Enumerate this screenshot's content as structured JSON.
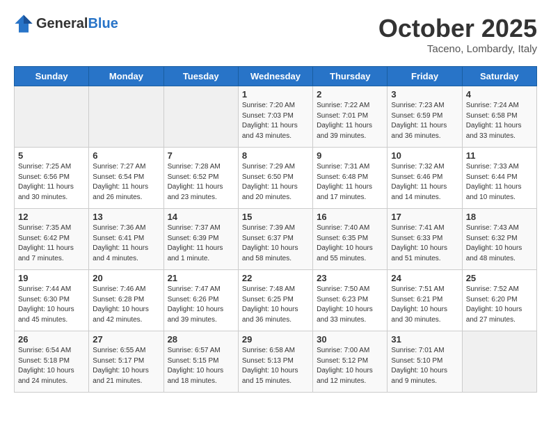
{
  "header": {
    "logo_line1": "General",
    "logo_line2": "Blue",
    "month": "October 2025",
    "location": "Taceno, Lombardy, Italy"
  },
  "days_of_week": [
    "Sunday",
    "Monday",
    "Tuesday",
    "Wednesday",
    "Thursday",
    "Friday",
    "Saturday"
  ],
  "weeks": [
    [
      {
        "day": "",
        "content": ""
      },
      {
        "day": "",
        "content": ""
      },
      {
        "day": "",
        "content": ""
      },
      {
        "day": "1",
        "content": "Sunrise: 7:20 AM\nSunset: 7:03 PM\nDaylight: 11 hours\nand 43 minutes."
      },
      {
        "day": "2",
        "content": "Sunrise: 7:22 AM\nSunset: 7:01 PM\nDaylight: 11 hours\nand 39 minutes."
      },
      {
        "day": "3",
        "content": "Sunrise: 7:23 AM\nSunset: 6:59 PM\nDaylight: 11 hours\nand 36 minutes."
      },
      {
        "day": "4",
        "content": "Sunrise: 7:24 AM\nSunset: 6:58 PM\nDaylight: 11 hours\nand 33 minutes."
      }
    ],
    [
      {
        "day": "5",
        "content": "Sunrise: 7:25 AM\nSunset: 6:56 PM\nDaylight: 11 hours\nand 30 minutes."
      },
      {
        "day": "6",
        "content": "Sunrise: 7:27 AM\nSunset: 6:54 PM\nDaylight: 11 hours\nand 26 minutes."
      },
      {
        "day": "7",
        "content": "Sunrise: 7:28 AM\nSunset: 6:52 PM\nDaylight: 11 hours\nand 23 minutes."
      },
      {
        "day": "8",
        "content": "Sunrise: 7:29 AM\nSunset: 6:50 PM\nDaylight: 11 hours\nand 20 minutes."
      },
      {
        "day": "9",
        "content": "Sunrise: 7:31 AM\nSunset: 6:48 PM\nDaylight: 11 hours\nand 17 minutes."
      },
      {
        "day": "10",
        "content": "Sunrise: 7:32 AM\nSunset: 6:46 PM\nDaylight: 11 hours\nand 14 minutes."
      },
      {
        "day": "11",
        "content": "Sunrise: 7:33 AM\nSunset: 6:44 PM\nDaylight: 11 hours\nand 10 minutes."
      }
    ],
    [
      {
        "day": "12",
        "content": "Sunrise: 7:35 AM\nSunset: 6:42 PM\nDaylight: 11 hours\nand 7 minutes."
      },
      {
        "day": "13",
        "content": "Sunrise: 7:36 AM\nSunset: 6:41 PM\nDaylight: 11 hours\nand 4 minutes."
      },
      {
        "day": "14",
        "content": "Sunrise: 7:37 AM\nSunset: 6:39 PM\nDaylight: 11 hours\nand 1 minute."
      },
      {
        "day": "15",
        "content": "Sunrise: 7:39 AM\nSunset: 6:37 PM\nDaylight: 10 hours\nand 58 minutes."
      },
      {
        "day": "16",
        "content": "Sunrise: 7:40 AM\nSunset: 6:35 PM\nDaylight: 10 hours\nand 55 minutes."
      },
      {
        "day": "17",
        "content": "Sunrise: 7:41 AM\nSunset: 6:33 PM\nDaylight: 10 hours\nand 51 minutes."
      },
      {
        "day": "18",
        "content": "Sunrise: 7:43 AM\nSunset: 6:32 PM\nDaylight: 10 hours\nand 48 minutes."
      }
    ],
    [
      {
        "day": "19",
        "content": "Sunrise: 7:44 AM\nSunset: 6:30 PM\nDaylight: 10 hours\nand 45 minutes."
      },
      {
        "day": "20",
        "content": "Sunrise: 7:46 AM\nSunset: 6:28 PM\nDaylight: 10 hours\nand 42 minutes."
      },
      {
        "day": "21",
        "content": "Sunrise: 7:47 AM\nSunset: 6:26 PM\nDaylight: 10 hours\nand 39 minutes."
      },
      {
        "day": "22",
        "content": "Sunrise: 7:48 AM\nSunset: 6:25 PM\nDaylight: 10 hours\nand 36 minutes."
      },
      {
        "day": "23",
        "content": "Sunrise: 7:50 AM\nSunset: 6:23 PM\nDaylight: 10 hours\nand 33 minutes."
      },
      {
        "day": "24",
        "content": "Sunrise: 7:51 AM\nSunset: 6:21 PM\nDaylight: 10 hours\nand 30 minutes."
      },
      {
        "day": "25",
        "content": "Sunrise: 7:52 AM\nSunset: 6:20 PM\nDaylight: 10 hours\nand 27 minutes."
      }
    ],
    [
      {
        "day": "26",
        "content": "Sunrise: 6:54 AM\nSunset: 5:18 PM\nDaylight: 10 hours\nand 24 minutes."
      },
      {
        "day": "27",
        "content": "Sunrise: 6:55 AM\nSunset: 5:17 PM\nDaylight: 10 hours\nand 21 minutes."
      },
      {
        "day": "28",
        "content": "Sunrise: 6:57 AM\nSunset: 5:15 PM\nDaylight: 10 hours\nand 18 minutes."
      },
      {
        "day": "29",
        "content": "Sunrise: 6:58 AM\nSunset: 5:13 PM\nDaylight: 10 hours\nand 15 minutes."
      },
      {
        "day": "30",
        "content": "Sunrise: 7:00 AM\nSunset: 5:12 PM\nDaylight: 10 hours\nand 12 minutes."
      },
      {
        "day": "31",
        "content": "Sunrise: 7:01 AM\nSunset: 5:10 PM\nDaylight: 10 hours\nand 9 minutes."
      },
      {
        "day": "",
        "content": ""
      }
    ]
  ]
}
